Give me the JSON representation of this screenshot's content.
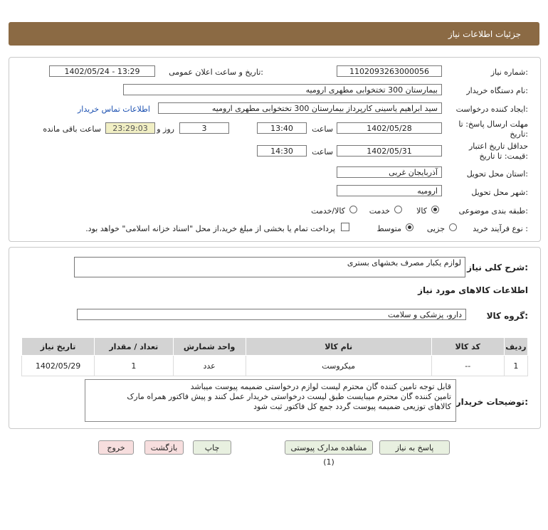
{
  "header": {
    "title": "جزئیات اطلاعات نیاز"
  },
  "form": {
    "need_number": {
      "label": "شماره نیاز:",
      "value": "1102093263000056"
    },
    "announce": {
      "label": "تاریخ و ساعت اعلان عمومی:",
      "value": "1402/05/24 - 13:29"
    },
    "buyer_org": {
      "label": "نام دستگاه خریدار:",
      "value": "بیمارستان 300 تختخوابی مطهری  ارومیه"
    },
    "requester": {
      "label": "ایجاد کننده درخواست:",
      "value": "سید ابراهیم یاسینی کارپرداز بیمارستان 300 تختخوابی مطهری  ارومیه",
      "contact_link": "اطلاعات تماس خریدار"
    },
    "reply_deadline": {
      "label_line1": "مهلت ارسال پاسخ: تا",
      "label_line2": "تاریخ:",
      "date": "1402/05/28",
      "time_label": "ساعت",
      "time": "13:40",
      "days": "3",
      "days_label": "روز و",
      "remaining": "23:29:03",
      "remaining_label": "ساعت باقی مانده"
    },
    "validity": {
      "label_line1": "حداقل تاریخ اعتبار",
      "label_line2": "قیمت: تا تاریخ:",
      "date": "1402/05/31",
      "time_label": "ساعت",
      "time": "14:30"
    },
    "province": {
      "label": "استان محل تحویل:",
      "value": "آذربایجان غربی"
    },
    "city": {
      "label": "شهر محل تحویل:",
      "value": "ارومیه"
    },
    "category": {
      "label": "طبقه بندی موضوعی:",
      "options": [
        "کالا",
        "خدمت",
        "کالا/خدمت"
      ],
      "selected": "کالا"
    },
    "process": {
      "label": "نوع فرآیند خرید :",
      "options": [
        "جزیی",
        "متوسط"
      ],
      "selected": "متوسط",
      "payment_note": "پرداخت تمام یا بخشی از مبلغ خرید،از محل \"اسناد خزانه اسلامی\" خواهد بود."
    }
  },
  "description": {
    "label": "شرح کلی نیاز:",
    "value": "لوازم یکبار مصرف بخشهای بستری"
  },
  "goods_section": {
    "title": "اطلاعات کالاهای مورد نیاز",
    "group_label": "گروه کالا:",
    "group_value": "دارو، پزشکی و سلامت"
  },
  "table": {
    "headers": [
      "ردیف",
      "کد کالا",
      "نام کالا",
      "واحد شمارش",
      "تعداد / مقدار",
      "تاریخ نیاز"
    ],
    "rows": [
      [
        "1",
        "--",
        "میکروست",
        "عدد",
        "1",
        "1402/05/29"
      ]
    ]
  },
  "buyer_notes": {
    "label": "توضیحات خریدار:",
    "lines": [
      "قابل توجه تامین کننده گان محترم لیست لوازم درخواستی ضمیمه پیوست میباشد",
      "تامین کننده گان محترم میبایست طبق لیست درخواستی خریدار عمل کنند و پیش فاکتور همراه مارک",
      "کالاهای توزیعی ضمیمه پیوست گردد جمع کل فاکتور ثبت شود"
    ]
  },
  "buttons": {
    "reply": "پاسخ به نیاز",
    "attachments": "مشاهده مدارک پیوستی (1)",
    "print": "چاپ",
    "back": "بازگشت",
    "exit": "خروج"
  }
}
